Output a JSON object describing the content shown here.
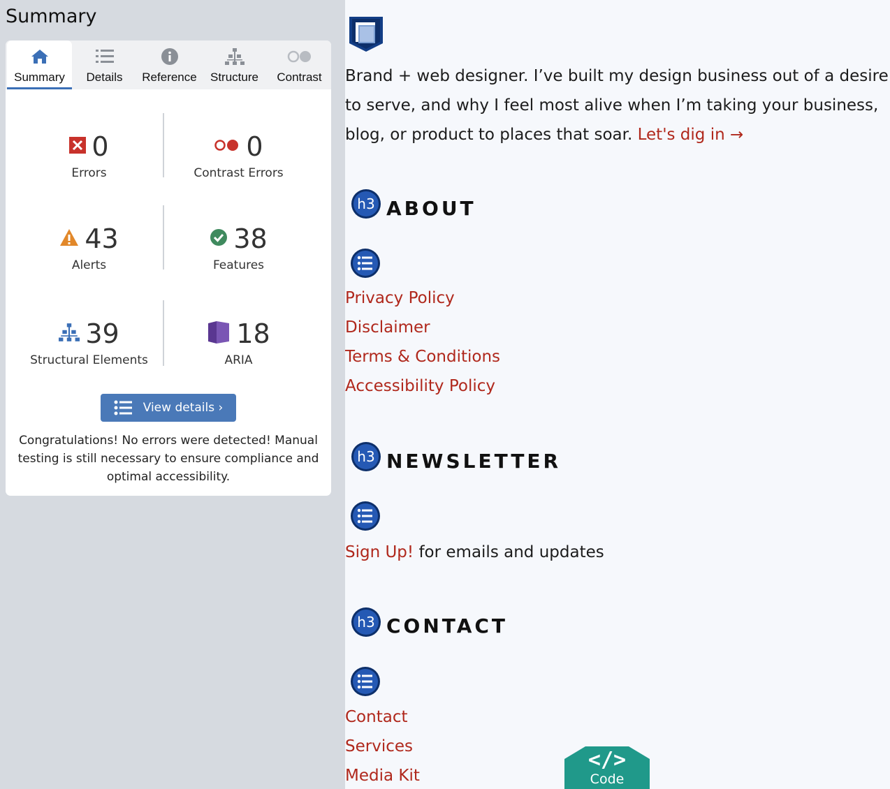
{
  "panel": {
    "title": "Summary",
    "tabs": [
      {
        "label": "Summary",
        "icon": "home-icon"
      },
      {
        "label": "Details",
        "icon": "list-icon"
      },
      {
        "label": "Reference",
        "icon": "info-icon"
      },
      {
        "label": "Structure",
        "icon": "structure-icon"
      },
      {
        "label": "Contrast",
        "icon": "contrast-icon"
      }
    ],
    "stats": {
      "errors": {
        "value": "0",
        "label": "Errors"
      },
      "contrast_errors": {
        "value": "0",
        "label": "Contrast Errors"
      },
      "alerts": {
        "value": "43",
        "label": "Alerts"
      },
      "features": {
        "value": "38",
        "label": "Features"
      },
      "structural": {
        "value": "39",
        "label": "Structural Elements"
      },
      "aria": {
        "value": "18",
        "label": "ARIA"
      }
    },
    "view_details_label": "View details ›",
    "congrats": "Congratulations! No errors were detected! Manual testing is still necessary to ensure compliance and optimal accessibility."
  },
  "page": {
    "intro_text": "Brand + web designer. I’ve built my design business out of a desire to serve, and why I feel most alive when I’m taking your business, blog, or product to places that soar. ",
    "intro_link": "Let's dig in →",
    "h3_badge": "h3",
    "about": {
      "heading": "ABOUT",
      "links": [
        "Privacy Policy",
        "Disclaimer",
        "Terms & Conditions",
        "Accessibility Policy"
      ]
    },
    "newsletter": {
      "heading": "NEWSLETTER",
      "link": "Sign Up!",
      "text": " for emails and updates"
    },
    "contact": {
      "heading": "CONTACT",
      "links": [
        "Contact",
        "Services",
        "Media Kit"
      ]
    },
    "code_button": {
      "glyph": "</>",
      "label": "Code"
    }
  },
  "colors": {
    "accent_blue": "#4a79b8",
    "error_red": "#c8322b",
    "alert_orange": "#e2882a",
    "feature_green": "#3f8a5e",
    "aria_purple": "#5a3791",
    "link_red": "#b0281c",
    "code_teal": "#20998a"
  }
}
